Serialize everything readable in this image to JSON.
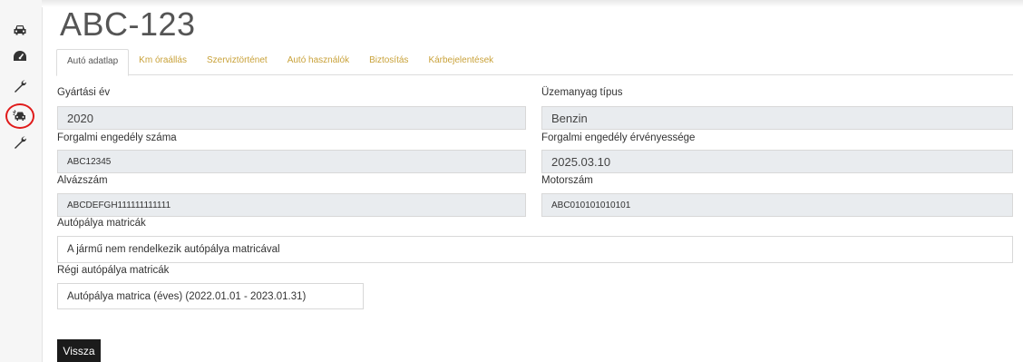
{
  "sidebar": {
    "icons": [
      "car-icon",
      "speedometer-icon",
      "wrench-icon",
      "car-damage-icon",
      "wrench-icon"
    ]
  },
  "page": {
    "title": "ABC-123"
  },
  "tabs": [
    {
      "label": "Autó adatlap",
      "active": true
    },
    {
      "label": "Km óraállás",
      "active": false
    },
    {
      "label": "Szerviztörténet",
      "active": false
    },
    {
      "label": "Autó használók",
      "active": false
    },
    {
      "label": "Biztosítás",
      "active": false
    },
    {
      "label": "Kárbejelentések",
      "active": false
    }
  ],
  "form": {
    "manufacture_year": {
      "label": "Gyártási év",
      "value": "2020"
    },
    "fuel_type": {
      "label": "Üzemanyag típus",
      "value": "Benzin"
    },
    "registration_number": {
      "label": "Forgalmi engedély száma",
      "value": "ABC12345"
    },
    "registration_validity": {
      "label": "Forgalmi engedély érvényessége",
      "value": "2025.03.10"
    },
    "chassis_number": {
      "label": "Alvázszám",
      "value": "ABCDEFGH111111111111"
    },
    "engine_number": {
      "label": "Motorszám",
      "value": "ABC010101010101"
    },
    "highway_vignettes": {
      "label": "Autópálya matricák",
      "value": "A jármű nem rendelkezik autópálya matricával"
    },
    "old_highway_vignettes": {
      "label": "Régi autópálya matricák",
      "value": "Autópálya matrica (éves) (2022.01.01 - 2023.01.31)"
    }
  },
  "actions": {
    "back_label": "Vissza"
  },
  "colors": {
    "tab_link": "#c9a23a",
    "highlight_circle": "#e01b1b",
    "button_bg": "#1b1b1b"
  }
}
